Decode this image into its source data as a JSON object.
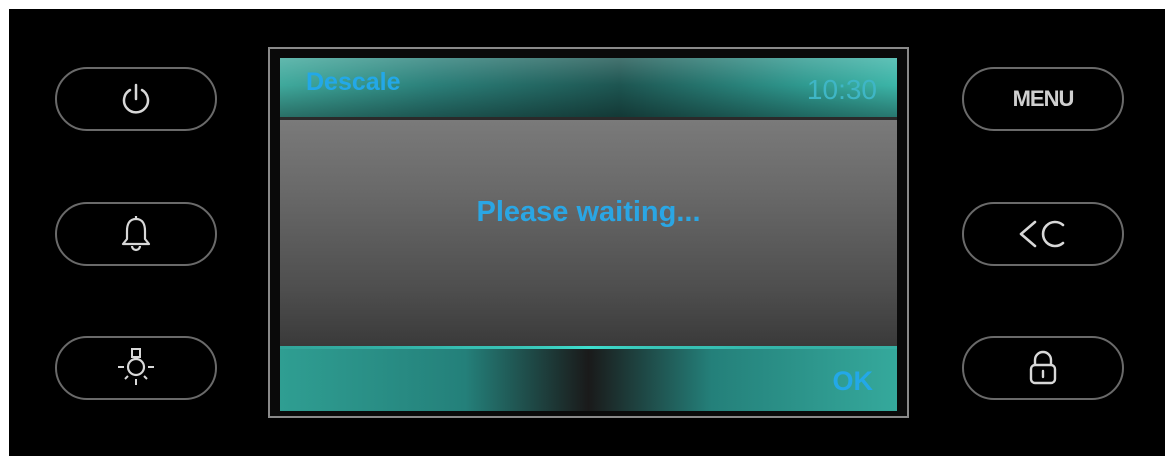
{
  "screen": {
    "title": "Descale",
    "clock": "10:30",
    "message": "Please waiting...",
    "ok_label": "OK"
  },
  "left_buttons": [
    {
      "icon": "power-icon"
    },
    {
      "icon": "bell-icon"
    },
    {
      "icon": "light-icon"
    }
  ],
  "right_buttons": [
    {
      "label": "MENU"
    },
    {
      "icon": "back-icon"
    },
    {
      "icon": "lock-icon"
    }
  ],
  "colors": {
    "accent_text": "#23a8e8",
    "teal_bar": "#2b7f79",
    "frame_border": "#6a6a6a",
    "panel_background": "#000000"
  }
}
